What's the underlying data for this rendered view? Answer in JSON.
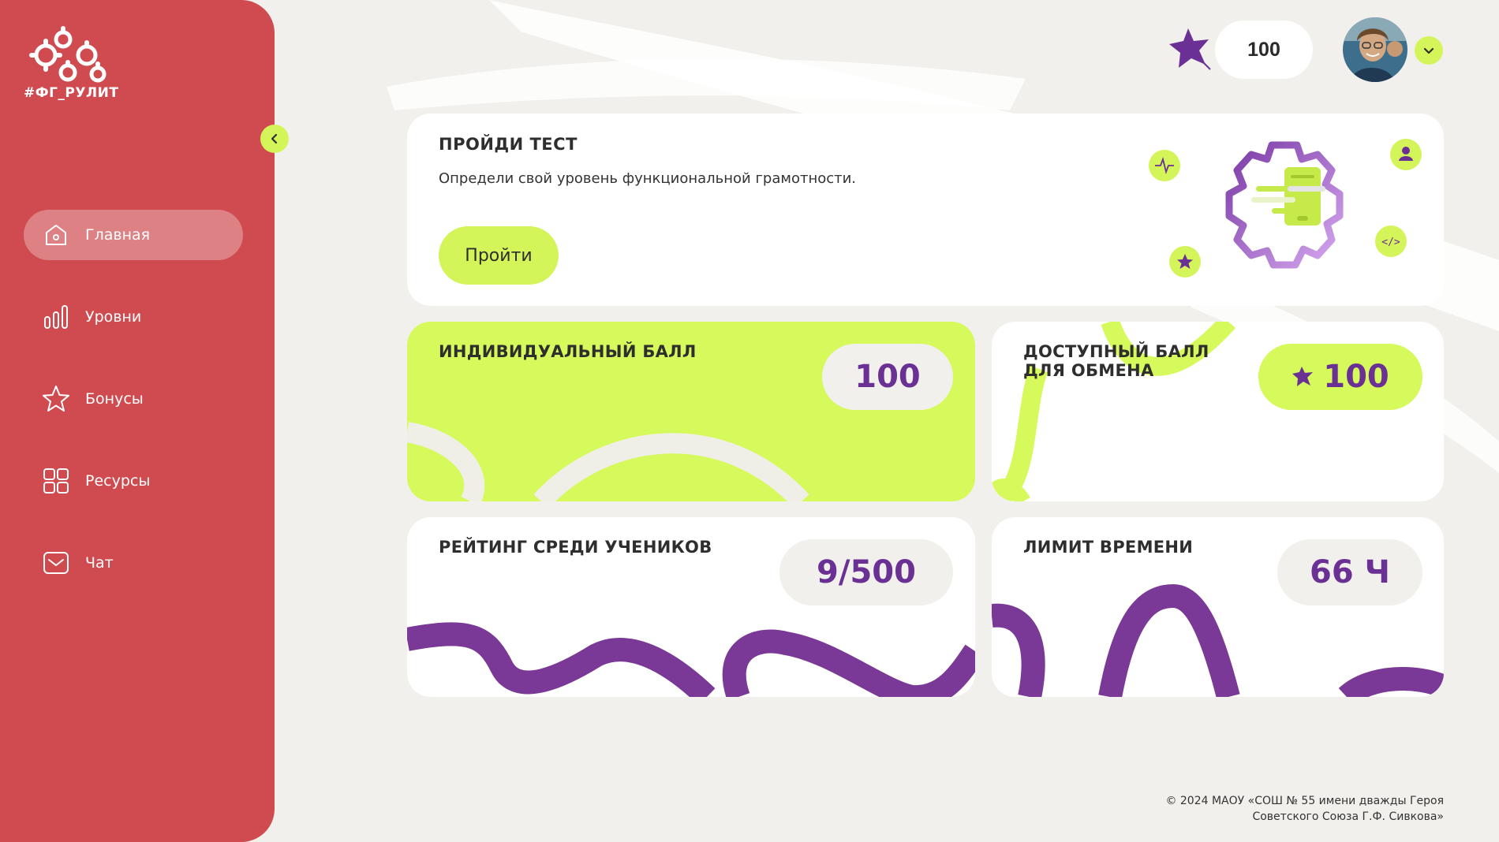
{
  "brand": {
    "logo_text": "#ФГ_РУЛИТ"
  },
  "sidebar": {
    "items": [
      {
        "label": "Главная",
        "icon": "home-icon",
        "active": true
      },
      {
        "label": "Уровни",
        "icon": "levels-bar-icon",
        "active": false
      },
      {
        "label": "Бонусы",
        "icon": "star-icon",
        "active": false
      },
      {
        "label": "Ресурсы",
        "icon": "grid-icon",
        "active": false
      },
      {
        "label": "Чат",
        "icon": "chat-icon",
        "active": false
      }
    ]
  },
  "header": {
    "points": "100"
  },
  "test_card": {
    "title": "ПРОЙДИ ТЕСТ",
    "description": "Определи свой уровень функциональной грамотности.",
    "button_label": "Пройти"
  },
  "stats": {
    "individual": {
      "title": "ИНДИВИДУАЛЬНЫЙ БАЛЛ",
      "value": "100"
    },
    "exchange": {
      "title_line1": "ДОСТУПНЫЙ БАЛЛ",
      "title_line2": "ДЛЯ ОБМЕНА",
      "value": "100"
    },
    "rating": {
      "title": "РЕЙТИНГ СРЕДИ УЧЕНИКОВ",
      "value": "9/500"
    },
    "time_limit": {
      "title": "ЛИМИТ ВРЕМЕНИ",
      "value": "66 Ч"
    }
  },
  "footer": {
    "line1": "© 2024 МАОУ «СОШ № 55 имени дважды Героя",
    "line2": "Советского Союза Г.Ф. Сивкова»"
  },
  "colors": {
    "sidebar": "#cf4b4f",
    "accent_lime": "#d4f55a",
    "accent_purple": "#6a3094",
    "background": "#f1f0ec"
  }
}
